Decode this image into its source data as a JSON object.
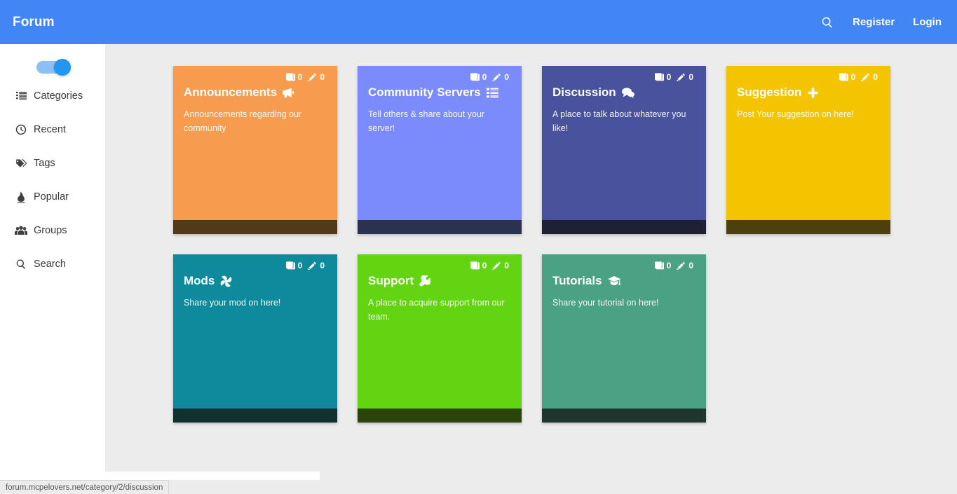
{
  "header": {
    "brand": "Forum",
    "search_icon": "search-icon",
    "register_label": "Register",
    "login_label": "Login"
  },
  "sidebar": {
    "toggle": {
      "name": "night-mode-toggle",
      "state": "on"
    },
    "items": [
      {
        "icon": "list-ul-icon",
        "label": "Categories"
      },
      {
        "icon": "clock-icon",
        "label": "Recent"
      },
      {
        "icon": "tags-icon",
        "label": "Tags"
      },
      {
        "icon": "fire-icon",
        "label": "Popular"
      },
      {
        "icon": "users-icon",
        "label": "Groups"
      },
      {
        "icon": "search-icon",
        "label": "Search"
      }
    ]
  },
  "main": {
    "background": "#ececec",
    "cards": [
      {
        "title": "Announcements",
        "title_icon": "bullhorn-icon",
        "description": "Announcements regarding our community",
        "topics_icon": "book-icon",
        "topics": "0",
        "posts_icon": "pencil-icon",
        "posts": "0",
        "color": "#f79c4e",
        "footer_color": "#54381a"
      },
      {
        "title": "Community Servers",
        "title_icon": "list-icon",
        "description": "Tell others & share about your server!",
        "topics_icon": "book-icon",
        "topics": "0",
        "posts_icon": "pencil-icon",
        "posts": "0",
        "color": "#7b8bfb",
        "footer_color": "#2b3150"
      },
      {
        "title": "Discussion",
        "title_icon": "comments-icon",
        "description": "A place to talk about whatever you like!",
        "topics_icon": "book-icon",
        "topics": "0",
        "posts_icon": "pencil-icon",
        "posts": "0",
        "color": "#49529d",
        "footer_color": "#1e2136"
      },
      {
        "title": "Suggestion",
        "title_icon": "plus-icon",
        "description": "Post Your suggestion on here!",
        "topics_icon": "book-icon",
        "topics": "0",
        "posts_icon": "pencil-icon",
        "posts": "0",
        "color": "#f4c400",
        "footer_color": "#4e400c"
      },
      {
        "title": "Mods",
        "title_icon": "fan-icon",
        "description": "Share your mod on here!",
        "topics_icon": "book-icon",
        "topics": "0",
        "posts_icon": "pencil-icon",
        "posts": "0",
        "color": "#0f8a9c",
        "footer_color": "#10312f"
      },
      {
        "title": "Support",
        "title_icon": "wrench-icon",
        "description": "A place to acquire support from our team.",
        "topics_icon": "book-icon",
        "topics": "0",
        "posts_icon": "pencil-icon",
        "posts": "0",
        "color": "#62d411",
        "footer_color": "#2b440b"
      },
      {
        "title": "Tutorials",
        "title_icon": "graduation-cap-icon",
        "description": "Share your tutorial on here!",
        "topics_icon": "book-icon",
        "topics": "0",
        "posts_icon": "pencil-icon",
        "posts": "0",
        "color": "#4aa183",
        "footer_color": "#20352c"
      }
    ]
  },
  "status_bar": {
    "url": "forum.mcpelovers.net/category/2/discussion"
  }
}
